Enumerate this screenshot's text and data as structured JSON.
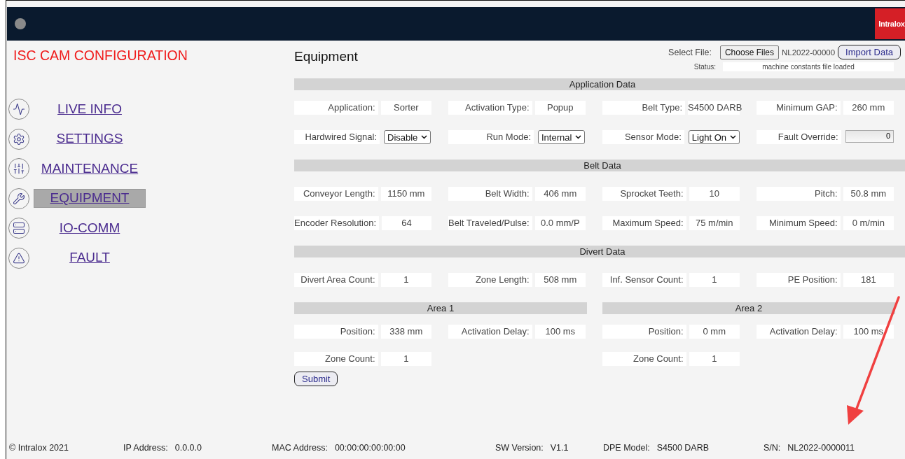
{
  "header": {
    "logo": "Intralox"
  },
  "sidebar": {
    "title": "ISC CAM CONFIGURATION",
    "items": [
      {
        "label": "LIVE INFO",
        "selected": false
      },
      {
        "label": "SETTINGS",
        "selected": false
      },
      {
        "label": "MAINTENANCE",
        "selected": false
      },
      {
        "label": "EQUIPMENT",
        "selected": true
      },
      {
        "label": "IO-COMM",
        "selected": false
      },
      {
        "label": "FAULT",
        "selected": false
      }
    ]
  },
  "page": {
    "title": "Equipment",
    "select_file_label": "Select File:",
    "choose_button": "Choose Files",
    "file_name": "NL2022-00000",
    "import_button": "Import Data",
    "status_label": "Status:",
    "status_value": "machine constants file loaded"
  },
  "sections": [
    {
      "title": "Application Data",
      "rows": [
        [
          {
            "label": "Application:",
            "kind": "value",
            "value": "Sorter"
          },
          {
            "label": "Activation Type:",
            "kind": "value",
            "value": "Popup"
          },
          {
            "label": "Belt Type:",
            "kind": "value",
            "value": "S4500 DARB"
          },
          {
            "label": "Minimum GAP:",
            "kind": "value",
            "value": "260 mm"
          }
        ],
        [
          {
            "label": "Hardwired Signal:",
            "kind": "select",
            "value": "Disable"
          },
          {
            "label": "Run Mode:",
            "kind": "select",
            "value": "Internal"
          },
          {
            "label": "Sensor Mode:",
            "kind": "select",
            "value": "Light On"
          },
          {
            "label": "Fault Override:",
            "kind": "input",
            "value": "0"
          }
        ]
      ]
    },
    {
      "title": "Belt Data",
      "rows": [
        [
          {
            "label": "Conveyor Length:",
            "kind": "value",
            "value": "1150 mm"
          },
          {
            "label": "Belt Width:",
            "kind": "value",
            "value": "406 mm"
          },
          {
            "label": "Sprocket Teeth:",
            "kind": "value",
            "value": "10"
          },
          {
            "label": "Pitch:",
            "kind": "value",
            "value": "50.8 mm"
          }
        ],
        [
          {
            "label": "Encoder Resolution:",
            "kind": "value",
            "value": "64"
          },
          {
            "label": "Belt Traveled/Pulse:",
            "kind": "value",
            "value": "0.0 mm/P"
          },
          {
            "label": "Maximum Speed:",
            "kind": "value",
            "value": "75 m/min"
          },
          {
            "label": "Minimum Speed:",
            "kind": "value",
            "value": "0 m/min"
          }
        ]
      ]
    },
    {
      "title": "Divert Data",
      "rows": [
        [
          {
            "label": "Divert Area Count:",
            "kind": "value",
            "value": "1"
          },
          {
            "label": "Zone Length:",
            "kind": "value",
            "value": "508 mm"
          },
          {
            "label": "Inf. Sensor Count:",
            "kind": "value",
            "value": "1"
          },
          {
            "label": "PE Position:",
            "kind": "value",
            "value": "181"
          }
        ]
      ]
    }
  ],
  "areas": [
    {
      "title": "Area 1",
      "rows": [
        [
          {
            "label": "Position:",
            "kind": "value",
            "value": "338 mm"
          },
          {
            "label": "Activation Delay:",
            "kind": "value",
            "value": "100 ms"
          }
        ],
        [
          {
            "label": "Zone Count:",
            "kind": "value",
            "value": "1"
          }
        ]
      ]
    },
    {
      "title": "Area 2",
      "rows": [
        [
          {
            "label": "Position:",
            "kind": "value",
            "value": "0 mm"
          },
          {
            "label": "Activation Delay:",
            "kind": "value",
            "value": "100 ms"
          }
        ],
        [
          {
            "label": "Zone Count:",
            "kind": "value",
            "value": "1"
          }
        ]
      ]
    }
  ],
  "submit": "Submit",
  "footer": [
    {
      "label": "© Intralox 2021"
    },
    {
      "label": "IP Address:",
      "value": "0.0.0.0"
    },
    {
      "label": "MAC Address:",
      "value": "00:00:00:00:00:00"
    },
    {
      "label": "SW Version:",
      "value": "V1.1"
    },
    {
      "label": "DPE Model:",
      "value": "S4500 DARB"
    },
    {
      "label": "S/N:",
      "value": "NL2022-0000011"
    }
  ],
  "annotations": [
    {
      "kind": "arrow",
      "color": "#f04040"
    }
  ]
}
